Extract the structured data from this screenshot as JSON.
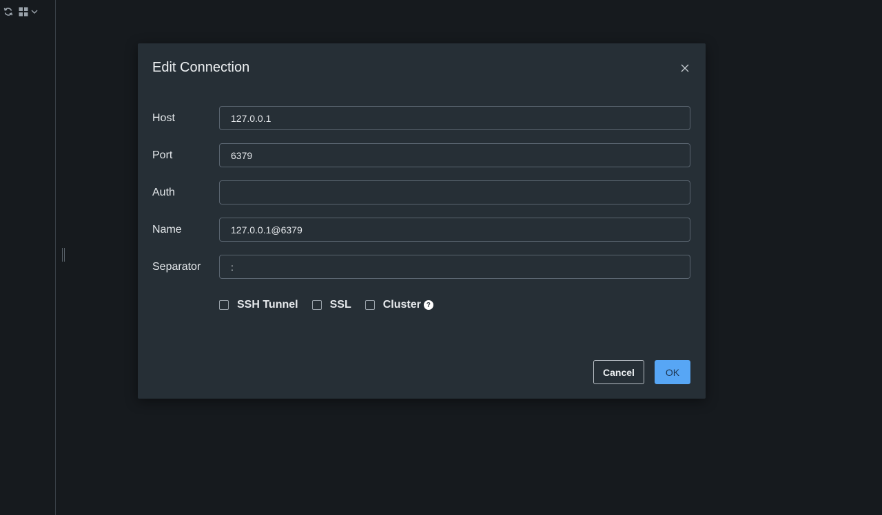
{
  "sidebar": {
    "icons": [
      "refresh-icon",
      "grid-icon",
      "chevron-down-icon"
    ]
  },
  "dialog": {
    "title": "Edit Connection",
    "fields": [
      {
        "label": "Host",
        "value": "127.0.0.1",
        "placeholder": ""
      },
      {
        "label": "Port",
        "value": "6379",
        "placeholder": ""
      },
      {
        "label": "Auth",
        "value": "",
        "placeholder": ""
      },
      {
        "label": "Name",
        "value": "127.0.0.1@6379",
        "placeholder": ""
      },
      {
        "label": "Separator",
        "value": ":",
        "placeholder": ""
      }
    ],
    "options": [
      {
        "label": "SSH Tunnel",
        "checked": false
      },
      {
        "label": "SSL",
        "checked": false
      },
      {
        "label": "Cluster",
        "checked": false,
        "help": "?"
      }
    ],
    "buttons": {
      "cancel": "Cancel",
      "ok": "OK"
    }
  },
  "colors": {
    "background": "#161a1e",
    "dialog": "#262f36",
    "accent": "#57a6f5"
  }
}
